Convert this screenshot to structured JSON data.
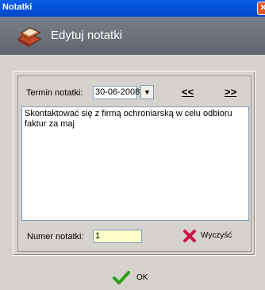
{
  "window": {
    "title": "Notatki",
    "close_symbol": "✕"
  },
  "header": {
    "title": "Edytuj notatki",
    "icon": "notes-books-icon"
  },
  "form": {
    "date_label": "Termin notatki:",
    "date_value": "30-06-2008",
    "prev_label": "<<",
    "next_label": ">>",
    "note_text": "Skontaktować się z firmą ochroniarską w celu odbioru faktur za maj",
    "number_label": "Numer notatki:",
    "number_value": "1",
    "clear_label": "Wyczyść"
  },
  "footer": {
    "ok_label": "OK"
  },
  "colors": {
    "titlebar": "#0451d9",
    "header": "#6b707a",
    "window_bg": "#d6d3ce",
    "number_field_bg": "#ffffcc",
    "clear_icon": "#cc1144",
    "ok_icon": "#2f9e1a"
  }
}
